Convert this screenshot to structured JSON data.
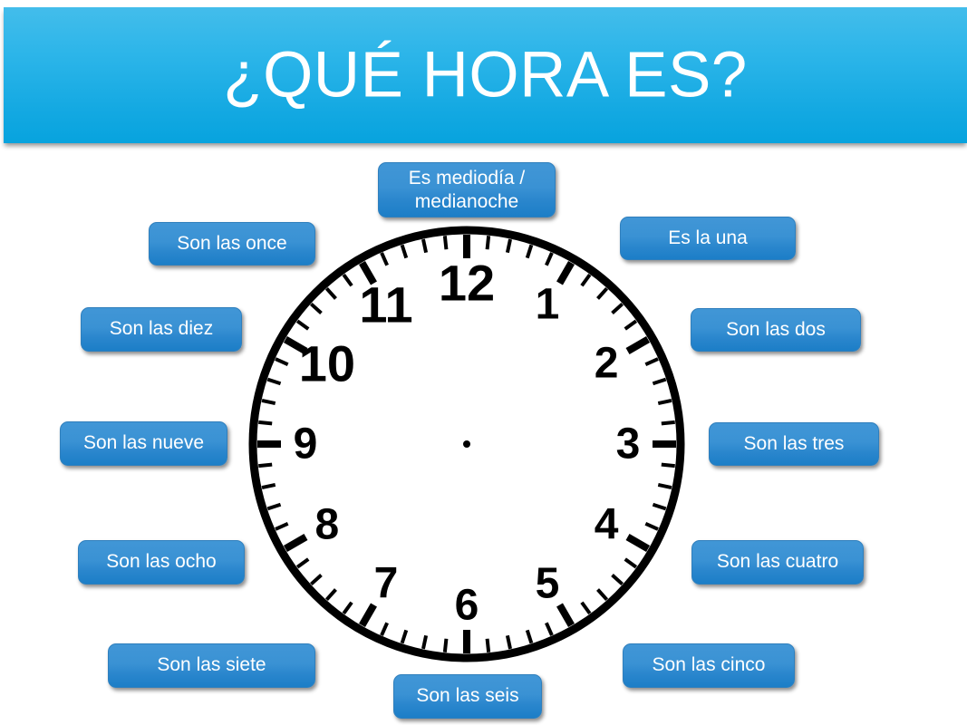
{
  "header": {
    "title": "¿QUÉ HORA ES?",
    "background_top_color": "#43bdeb",
    "background_bottom_color": "#07a3de",
    "text_color": "#ffffff"
  },
  "clock": {
    "numerals": [
      "12",
      "1",
      "2",
      "3",
      "4",
      "5",
      "6",
      "7",
      "8",
      "9",
      "10",
      "11"
    ],
    "numeral_color": "#000000",
    "ring_color": "#000000",
    "face_color": "#ffffff",
    "has_center_dot": true,
    "has_hands": false,
    "minute_ticks": 60
  },
  "phrases": {
    "accent_color": "#3a92d4",
    "text_color": "#ffffff",
    "twelve": "Es mediodía / medianoche",
    "one": "Es la una",
    "two": "Son las dos",
    "three": "Son las tres",
    "four": "Son las cuatro",
    "five": "Son las cinco",
    "six": "Son las seis",
    "seven": "Son las siete",
    "eight": "Son las ocho",
    "nine": "Son las nueve",
    "ten": "Son las diez",
    "eleven": "Son las once"
  }
}
